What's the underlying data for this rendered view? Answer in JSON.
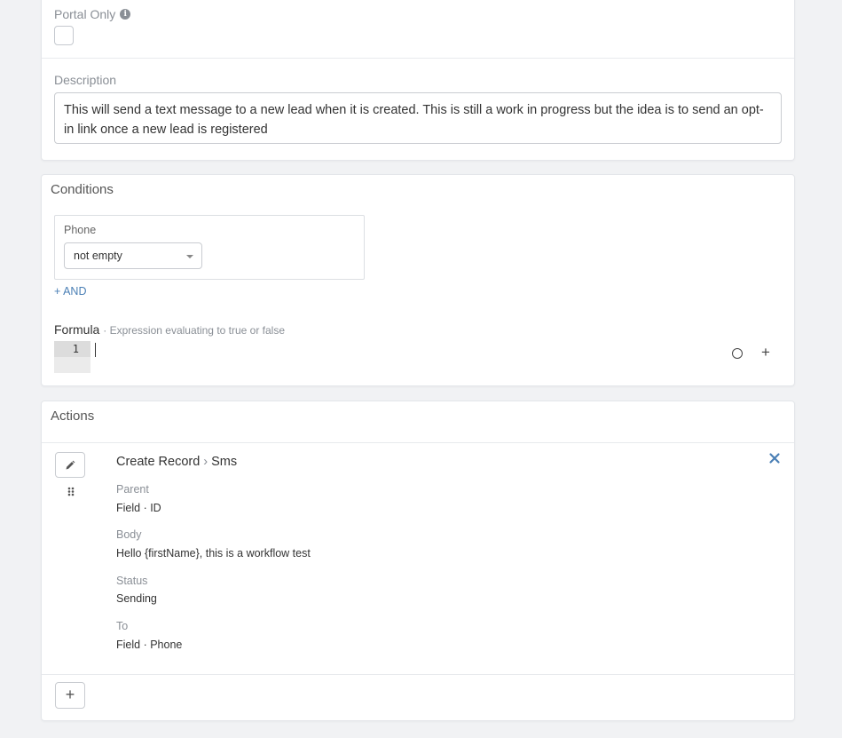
{
  "general": {
    "portal_only_label": "Portal Only",
    "portal_only_checked": false,
    "description_label": "Description",
    "description_value": "This will send a text message to a new lead when it is created. This is still a work in progress but the idea is to send an opt-in link once a new lead is registered"
  },
  "conditions": {
    "title": "Conditions",
    "items": [
      {
        "field": "Phone",
        "operator": "not empty"
      }
    ],
    "and_label": "+ AND",
    "formula_label": "Formula",
    "formula_hint": "· Expression evaluating to true or false",
    "formula_line_number": "1",
    "formula_add_label": "+"
  },
  "actions": {
    "title": "Actions",
    "items": [
      {
        "type": "Create Record",
        "separator": "›",
        "target": "Sms",
        "fields": [
          {
            "label": "Parent",
            "value": "Field · ID"
          },
          {
            "label": "Body",
            "value": "Hello {firstName}, this is a workflow test"
          },
          {
            "label": "Status",
            "value": "Sending"
          },
          {
            "label": "To",
            "value": "Field · Phone"
          }
        ]
      }
    ],
    "add_label": "+"
  },
  "icons": {
    "info": "info-icon",
    "caret": "caret-down-icon",
    "circle": "circle-icon",
    "edit": "pencil-icon",
    "drag": "drag-handle-icon",
    "remove": "close-icon"
  },
  "colors": {
    "link": "#4a7fb5",
    "background": "#f1f2f4",
    "panel": "#ffffff"
  }
}
